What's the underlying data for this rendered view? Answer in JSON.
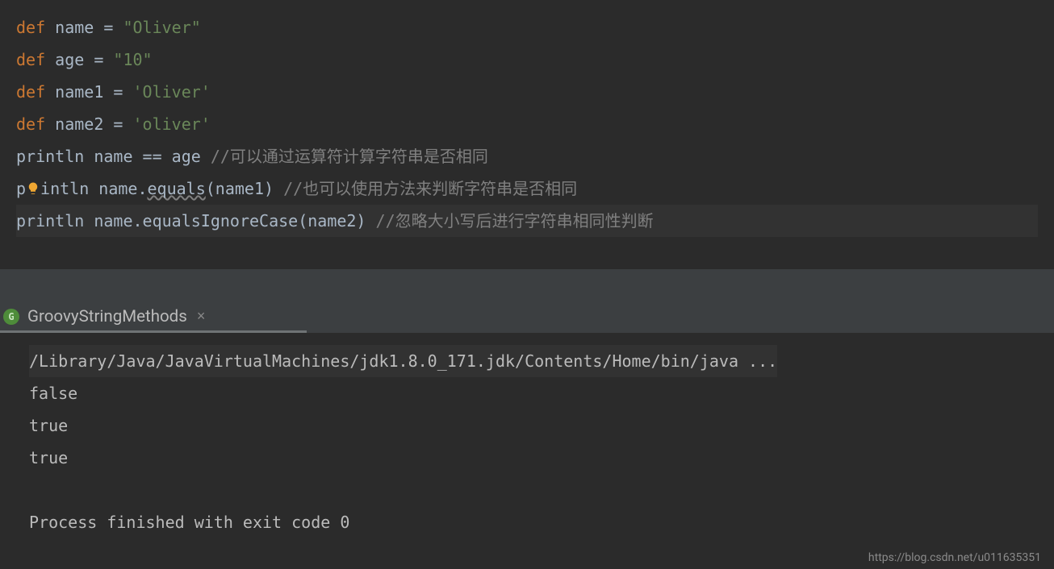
{
  "editor": {
    "lines": [
      {
        "segments": [
          {
            "t": "def ",
            "c": "kw"
          },
          {
            "t": "name = ",
            "c": ""
          },
          {
            "t": "\"Oliver\"",
            "c": "str"
          }
        ]
      },
      {
        "segments": [
          {
            "t": "def ",
            "c": "kw"
          },
          {
            "t": "age = ",
            "c": ""
          },
          {
            "t": "\"10\"",
            "c": "str"
          }
        ]
      },
      {
        "segments": [
          {
            "t": "def ",
            "c": "kw"
          },
          {
            "t": "name1 = ",
            "c": ""
          },
          {
            "t": "'Oliver'",
            "c": "str"
          }
        ]
      },
      {
        "segments": [
          {
            "t": "def ",
            "c": "kw"
          },
          {
            "t": "name2 = ",
            "c": ""
          },
          {
            "t": "'oliver'",
            "c": "str"
          }
        ]
      },
      {
        "segments": [
          {
            "t": "println name == age ",
            "c": ""
          },
          {
            "t": "//可以通过运算符计算字符串是否相同",
            "c": "cmt"
          }
        ]
      },
      {
        "bulb": true,
        "segments": [
          {
            "t": "p",
            "c": ""
          },
          {
            "t": "",
            "c": "bulb"
          },
          {
            "t": "intln name.",
            "c": ""
          },
          {
            "t": "equals",
            "c": "squiggle"
          },
          {
            "t": "(name1) ",
            "c": ""
          },
          {
            "t": "//也可以使用方法来判断字符串是否相同",
            "c": "cmt"
          }
        ]
      },
      {
        "highlight": true,
        "segments": [
          {
            "t": "println name.equalsIgnoreCase(name2) ",
            "c": ""
          },
          {
            "t": "//忽略大小写后进行字符串相同性判断",
            "c": "cmt"
          }
        ]
      }
    ]
  },
  "tab": {
    "icon_letter": "G",
    "title": "GroovyStringMethods",
    "close": "×"
  },
  "console": {
    "command": "/Library/Java/JavaVirtualMachines/jdk1.8.0_171.jdk/Contents/Home/bin/java ...",
    "output": [
      "false",
      "true",
      "true",
      "",
      "Process finished with exit code 0"
    ]
  },
  "watermark": "https://blog.csdn.net/u011635351"
}
